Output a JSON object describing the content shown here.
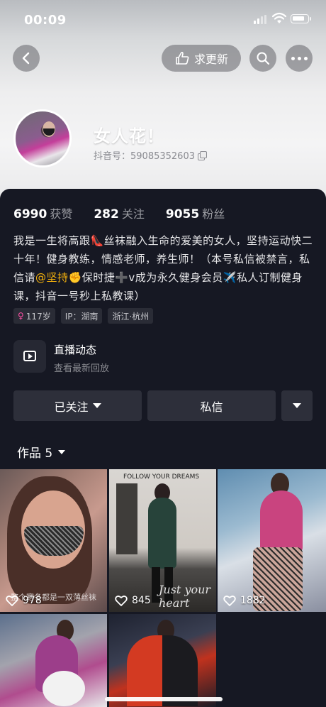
{
  "status_bar": {
    "time": "00:09"
  },
  "nav": {
    "request_update_label": "求更新"
  },
  "profile": {
    "nickname": "女人花！",
    "douyin_id": "抖音号：59085352603"
  },
  "stats": [
    {
      "value": "6990",
      "label": "获赞"
    },
    {
      "value": "282",
      "label": "关注"
    },
    {
      "value": "9055",
      "label": "粉丝"
    }
  ],
  "bio": {
    "part1": "我是一生将高跟👠丝袜融入生命的爱美的女人，坚持运动快二十年！健身教练，情感老师，养生师！（本号私信被禁言，私信请",
    "mention": "@坚持",
    "part2": "✊保时捷➕v成为永久健身会员✈️私人订制健身课，抖音一号秒上私教课）"
  },
  "tags": {
    "gender_symbol": "♀",
    "age": "117岁",
    "ip": "IP：湖南",
    "location": "浙江·杭州"
  },
  "live": {
    "title": "直播动态",
    "subtitle": "查看最新回放"
  },
  "actions": {
    "follow_label": "已关注",
    "message_label": "私信"
  },
  "works": {
    "label": "作品 5"
  },
  "videos": [
    {
      "likes": "978",
      "caption": "整个寒冬都是一双薄丝袜"
    },
    {
      "likes": "845",
      "overlay_text": "FOLLOW YOUR DREAMS",
      "script_text": "Just your heart"
    },
    {
      "likes": "1882"
    },
    {
      "likes": ""
    },
    {
      "likes": ""
    }
  ],
  "colors": {
    "background": "#161823",
    "mention": "#f5b20c",
    "female": "#ff4fa6",
    "button": "#2d2f3a"
  }
}
